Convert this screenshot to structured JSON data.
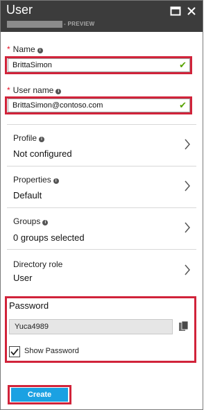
{
  "blade": {
    "title": "User",
    "subtitle_suffix": "- PREVIEW",
    "icons": [
      "maximize-icon",
      "close-icon"
    ]
  },
  "form": {
    "name": {
      "label": "Name",
      "value": "BrittaSimon",
      "required": true,
      "valid": true
    },
    "user_name": {
      "label": "User name",
      "value": "BrittaSimon@contoso.com",
      "required": true,
      "valid": true
    }
  },
  "sections": [
    {
      "label": "Profile",
      "value": "Not configured"
    },
    {
      "label": "Properties",
      "value": "Default"
    },
    {
      "label": "Groups",
      "value": "0 groups selected"
    },
    {
      "label": "Directory role",
      "value": "User"
    }
  ],
  "password": {
    "label": "Password",
    "value": "Yuca4989",
    "show_password_label": "Show Password",
    "show_password_checked": true
  },
  "actions": {
    "create_label": "Create"
  },
  "colors": {
    "header_bg": "#3c3c3c",
    "accent": "#1ba1e2",
    "highlight": "#d1233a",
    "valid": "#57a300",
    "required": "#e81123"
  }
}
